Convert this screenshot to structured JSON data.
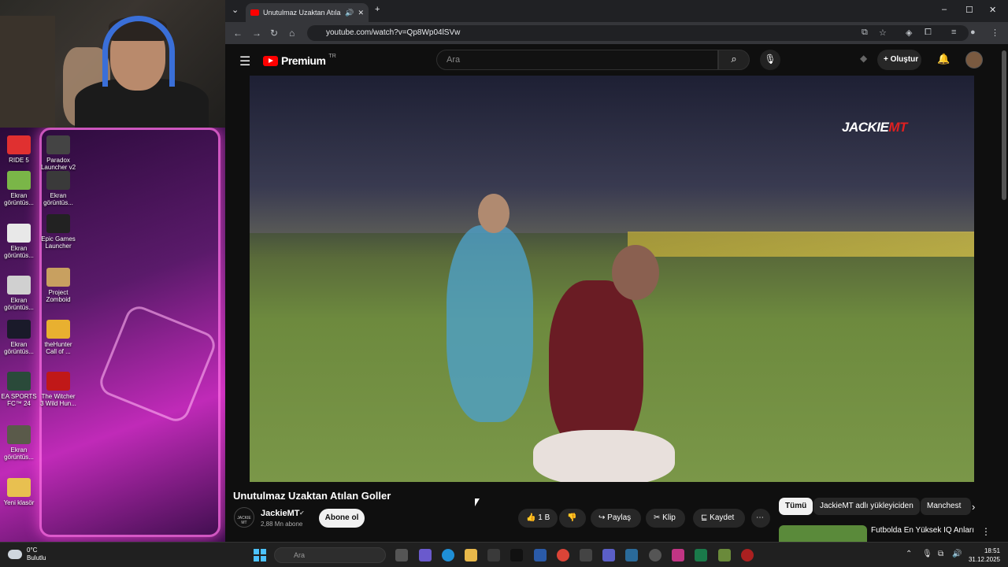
{
  "desktop": {
    "icons": [
      {
        "label": "RIDE 5",
        "color": "#e03030"
      },
      {
        "label": "Paradox Launcher v2",
        "color": "#444"
      },
      {
        "label": "Ekran görüntüs...",
        "color": "#7ab648"
      },
      {
        "label": "Ekran görüntüs...",
        "color": "#3a3a3a"
      },
      {
        "label": "Ekran görüntüs...",
        "color": "#e8e8e8"
      },
      {
        "label": "Epic Games Launcher",
        "color": "#222"
      },
      {
        "label": "Ekran görüntüs...",
        "color": "#d0d0d0"
      },
      {
        "label": "Project Zomboid",
        "color": "#c8a060"
      },
      {
        "label": "Ekran görüntüs...",
        "color": "#1a1a2a"
      },
      {
        "label": "theHunter Call of ...",
        "color": "#e8b030"
      },
      {
        "label": "EA SPORTS FC™ 24",
        "color": "#2a4a3a"
      },
      {
        "label": "The Witcher 3 Wild Hun...",
        "color": "#c01818"
      },
      {
        "label": "Ekran görüntüs...",
        "color": "#5a5a4a"
      },
      {
        "label": "Yeni klasör",
        "color": "#e8c050"
      }
    ]
  },
  "browser": {
    "tab_title": "Unutulmaz Uzaktan Atılan G",
    "url": "youtube.com/watch?v=Qp8Wp04lSVw"
  },
  "youtube": {
    "logo_text": "Premium",
    "logo_region": "TR",
    "search_placeholder": "Ara",
    "create_label": "Oluştur",
    "watermark_a": "JACKIE",
    "watermark_b": "MT",
    "video_title": "Unutulmaz Uzaktan Atılan Goller",
    "channel_name": "JackieMT",
    "channel_avatar_text": "JACKIE MT",
    "subscribers": "2,88 Mn abone",
    "subscribe_label": "Abone ol",
    "like_count": "1 B",
    "share_label": "Paylaş",
    "clip_label": "Klip",
    "save_label": "Kaydet",
    "chips": [
      "Tümü",
      "JackieMT adlı yükleyiciden",
      "Manchest"
    ],
    "rec_title": "Futbolda En Yüksek IQ Anları"
  },
  "taskbar": {
    "temp": "0°C",
    "weather": "Bulutlu",
    "search_placeholder": "Ara",
    "time": "18:51",
    "date": "31.12.2025"
  }
}
